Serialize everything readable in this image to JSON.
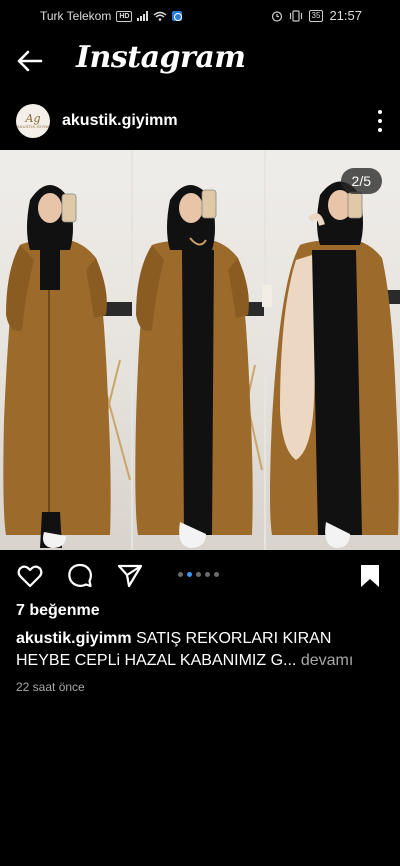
{
  "status_bar": {
    "carrier": "Turk Telekom",
    "network_badge": "HD",
    "battery": "35",
    "time": "21:57"
  },
  "header": {
    "title": "Instagram",
    "back_icon": "arrow-left-icon"
  },
  "post": {
    "username": "akustik.giyimm",
    "avatar_text": "Ag",
    "avatar_subtext": "AKUSTIK.GIYIM",
    "image_counter": "2/5",
    "carousel": {
      "count": 5,
      "active_index": 1
    },
    "coat_color": "#9c6a2a",
    "likes": "7 beğenme",
    "caption_user": "akustik.giyimm",
    "caption_text": "SATIŞ REKORLARI KIRAN HEYBE CEPLi  HAZAL KABANIMIZ G...",
    "caption_more": " devamı",
    "time_ago": "22 saat önce"
  },
  "icons": [
    "heart-icon",
    "comment-icon",
    "share-icon",
    "bookmark-icon",
    "more-icon"
  ],
  "colors": {
    "background": "#000000",
    "text": "#ffffff",
    "muted": "#a8a8a8",
    "accent": "#3897f0"
  }
}
